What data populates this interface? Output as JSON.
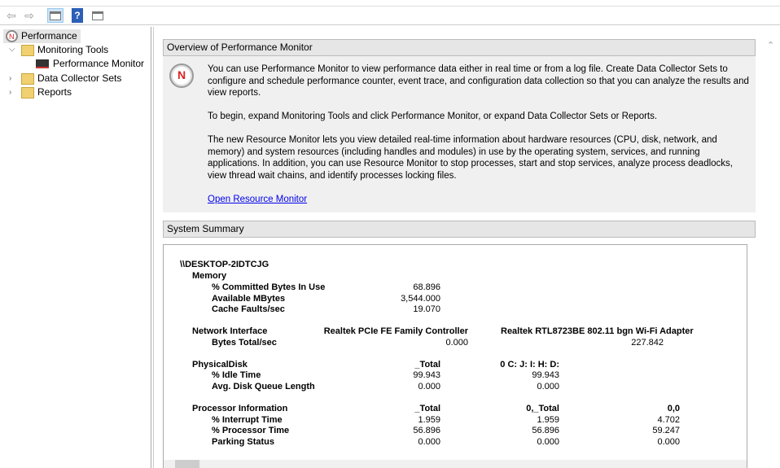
{
  "toolbar": {
    "buttons": [
      "back",
      "forward",
      "show-hide-console-tree",
      "help",
      "show-hide-action-pane"
    ]
  },
  "tree": {
    "root": "Performance",
    "items": [
      {
        "label": "Monitoring Tools",
        "expanded": true,
        "children": [
          "Performance Monitor"
        ]
      },
      {
        "label": "Data Collector Sets",
        "expanded": false
      },
      {
        "label": "Reports",
        "expanded": false
      }
    ]
  },
  "overview": {
    "title": "Overview of Performance Monitor",
    "p1": "You can use Performance Monitor to view performance data either in real time or from a log file. Create Data Collector Sets to configure and schedule performance counter, event trace, and configuration data collection so that you can analyze the results and view reports.",
    "p2": "To begin, expand Monitoring Tools and click Performance Monitor, or expand Data Collector Sets or Reports.",
    "p3": "The new Resource Monitor lets you view detailed real-time information about hardware resources (CPU, disk, network, and memory) and system resources (including handles and modules) in use by the operating system, services, and running applications. In addition, you can use Resource Monitor to stop processes, start and stop services, analyze process deadlocks, view thread wait chains, and identify processes locking files.",
    "link": "Open Resource Monitor"
  },
  "summary": {
    "title": "System Summary",
    "host": "\\\\DESKTOP-2IDTCJG",
    "memory": {
      "label": "Memory",
      "rows": [
        [
          "% Committed Bytes In Use",
          "68.896"
        ],
        [
          "Available MBytes",
          "3,544.000"
        ],
        [
          "Cache Faults/sec",
          "19.070"
        ]
      ]
    },
    "network": {
      "label": "Network Interface",
      "cols": [
        "Realtek PCIe FE Family Controller",
        "Realtek RTL8723BE 802.11 bgn Wi-Fi Adapter"
      ],
      "rows": [
        [
          "Bytes Total/sec",
          "0.000",
          "227.842"
        ]
      ]
    },
    "disk": {
      "label": "PhysicalDisk",
      "cols": [
        "_Total",
        "0 C: J: I: H: D:"
      ],
      "rows": [
        [
          "% Idle Time",
          "99.943",
          "99.943"
        ],
        [
          "Avg. Disk Queue Length",
          "0.000",
          "0.000"
        ]
      ]
    },
    "processor": {
      "label": "Processor Information",
      "cols": [
        "_Total",
        "0,_Total",
        "0,0"
      ],
      "rows": [
        [
          "% Interrupt Time",
          "1.959",
          "1.959",
          "4.702"
        ],
        [
          "% Processor Time",
          "56.896",
          "56.896",
          "59.247"
        ],
        [
          "Parking Status",
          "0.000",
          "0.000",
          "0.000"
        ]
      ]
    }
  }
}
